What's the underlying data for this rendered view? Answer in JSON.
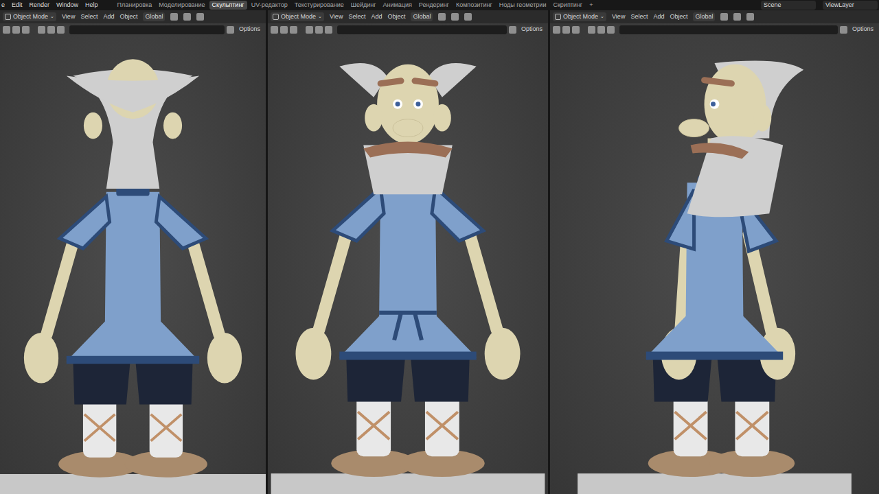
{
  "app_menu": [
    "e",
    "Edit",
    "Render",
    "Window",
    "Help"
  ],
  "workspaces": [
    {
      "label": "Планировка",
      "selected": false
    },
    {
      "label": "Моделирование",
      "selected": false
    },
    {
      "label": "Скульптинг",
      "selected": true
    },
    {
      "label": "UV-редактор",
      "selected": false
    },
    {
      "label": "Текстурирование",
      "selected": false
    },
    {
      "label": "Шейдинг",
      "selected": false
    },
    {
      "label": "Анимация",
      "selected": false
    },
    {
      "label": "Рендеринг",
      "selected": false
    },
    {
      "label": "Композитинг",
      "selected": false
    },
    {
      "label": "Ноды геометрии",
      "selected": false
    },
    {
      "label": "Скриптинг",
      "selected": false
    }
  ],
  "add_workspace": "+",
  "scene": "Scene",
  "view_layer": "ViewLayer",
  "viewports": [
    {
      "kind": "back",
      "mode": "Object Mode",
      "menus": [
        "View",
        "Select",
        "Add",
        "Object"
      ],
      "orientation": "Global",
      "options": "Options"
    },
    {
      "kind": "front",
      "mode": "Object Mode",
      "menus": [
        "View",
        "Select",
        "Add",
        "Object"
      ],
      "orientation": "Global",
      "options": "Options"
    },
    {
      "kind": "side",
      "mode": "Object Mode",
      "menus": [
        "View",
        "Select",
        "Add",
        "Object"
      ],
      "orientation": "Global",
      "options": "Options"
    }
  ]
}
